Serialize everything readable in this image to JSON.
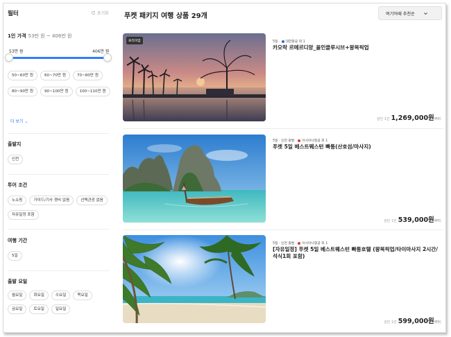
{
  "sidebar": {
    "title": "필터",
    "reset_label": "초기화",
    "price": {
      "title": "1인 가격",
      "range_text": "53만 원 ~ 406만 원",
      "min_label": "53만 원",
      "max_label": "406만 원",
      "chips": [
        "50~60만 원",
        "60~70만 원",
        "70~80만 원",
        "80~90만 원",
        "90~100만 원",
        "100~110만 원"
      ],
      "more_label": "더 보기"
    },
    "departure": {
      "title": "출발지",
      "chips": [
        "인천"
      ]
    },
    "tour": {
      "title": "투어 조건",
      "chips": [
        "노쇼핑",
        "가이드/기사 경비 없음",
        "선택관광 없음",
        "자유일정 포함"
      ]
    },
    "duration": {
      "title": "여행 기간",
      "chips": [
        "5일"
      ]
    },
    "weekday": {
      "title": "출발 요일",
      "chips": [
        "월요일",
        "화요일",
        "수요일",
        "목요일",
        "금요일",
        "토요일",
        "일요일"
      ]
    }
  },
  "main": {
    "title": "푸켓 패키지 여행 상품 29개",
    "sort_label": "여기어때 추천순",
    "products": [
      {
        "badge": "프리미엄",
        "meta_prefix": "5일 ·",
        "airline": "대한항공 외 1",
        "airline_color": "#2f6fd6",
        "name": "카오락 르메르디앙_올인클루시브+왕복픽업",
        "price_label": "성인 1인",
        "price": "1,269,000원",
        "price_suffix": "부터"
      },
      {
        "badge": "",
        "meta_prefix": "5일 · 인천 출발 ·",
        "airline": "아시아나항공 외 1",
        "airline_color": "#d43c3c",
        "name": "푸켓 5일 베스트웨스턴 빠통(산호섬/마사지)",
        "price_label": "성인 1인",
        "price": "539,000원",
        "price_suffix": "부터"
      },
      {
        "badge": "",
        "meta_prefix": "5일 · 인천 출발 ·",
        "airline": "아시아나항공 외 1",
        "airline_color": "#d43c3c",
        "name": "[자유일정] 푸켓 5일 베스트웨스턴 빠통호텔 (왕복픽업/타이마사지 2시간/석식1회 포함)",
        "price_label": "성인 1인",
        "price": "599,000원",
        "price_suffix": "부터"
      }
    ]
  },
  "colors": {
    "accent": "#2f7df6"
  }
}
